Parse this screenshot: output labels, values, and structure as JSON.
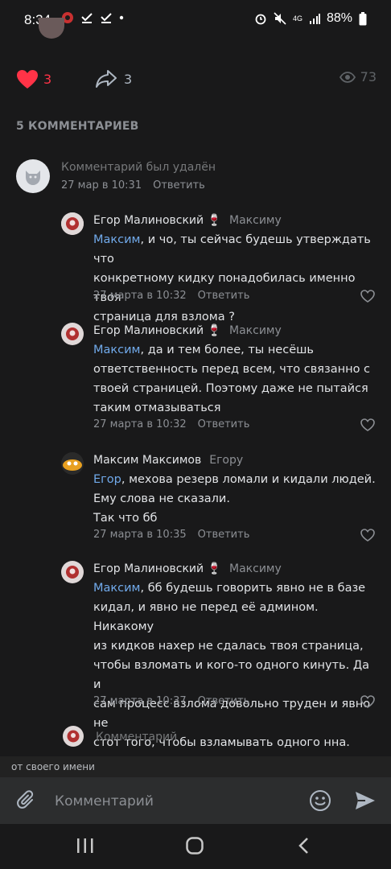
{
  "status_bar": {
    "time": "8:34",
    "battery": "88%",
    "network": "4G"
  },
  "post_actions": {
    "likes": "3",
    "shares": "3",
    "views": "73"
  },
  "comments_header": "5 КОММЕНТАРИЕВ",
  "comments": [
    {
      "deleted_text": "Комментарий был удалён",
      "date": "27 мар в 10:31",
      "reply_label": "Ответить"
    },
    {
      "author": "Егор Малиновский 🍷",
      "reply_to": "Максиму",
      "mention": "Максим",
      "lines": [
        ", и чо, ты сейчас будешь утверждать что",
        "конкретному кидку понадобилась именно твоя",
        "страница для взлома ?"
      ],
      "date": "27 марта в 10:32",
      "reply_label": "Ответить"
    },
    {
      "author": "Егор Малиновский 🍷",
      "reply_to": "Максиму",
      "mention": "Максим",
      "lines": [
        ", да и тем более, ты несёшь",
        "ответственность перед всем, что связанно с",
        "твоей страницей. Поэтому даже не пытайся",
        "таким отмазываться"
      ],
      "date": "27 марта в 10:32",
      "reply_label": "Ответить"
    },
    {
      "author": "Максим Максимов",
      "reply_to": "Егору",
      "mention": "Егор",
      "lines": [
        ", мехова резерв ломали и кидали людей.",
        "Ему слова не сказали.",
        "Так что бб"
      ],
      "date": "27 марта в 10:35",
      "reply_label": "Ответить"
    },
    {
      "author": "Егор Малиновский 🍷",
      "reply_to": "Максиму",
      "mention": "Максим",
      "lines": [
        ", бб будешь говорить явно не в базе",
        "кидал, и явно не перед её админом. Никакому",
        "из кидков нахер не сдалась твоя страница,",
        "чтобы взломать и кого-то одного кинуть. Да и",
        "сам процесс взлома довольно труден и явно не",
        "стот того, чтобы взламывать одного нна."
      ],
      "date": "27 марта в 10:37",
      "reply_label": "Ответить"
    }
  ],
  "reply_composer_placeholder": "Комментарий",
  "from_name_label": "от своего имени",
  "composer_placeholder": "Комментарий",
  "colors": {
    "background": "#19191a",
    "accent_link": "#71aaeb",
    "like_red": "#ff3347",
    "secondary_text": "#8c8f94"
  }
}
